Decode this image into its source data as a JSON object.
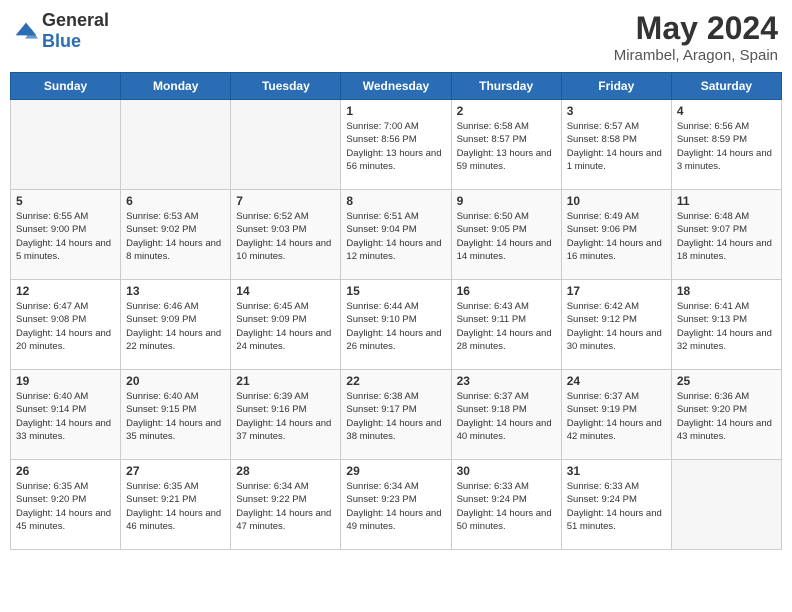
{
  "header": {
    "logo_general": "General",
    "logo_blue": "Blue",
    "month_year": "May 2024",
    "location": "Mirambel, Aragon, Spain"
  },
  "weekdays": [
    "Sunday",
    "Monday",
    "Tuesday",
    "Wednesday",
    "Thursday",
    "Friday",
    "Saturday"
  ],
  "weeks": [
    [
      {
        "day": "",
        "empty": true
      },
      {
        "day": "",
        "empty": true
      },
      {
        "day": "",
        "empty": true
      },
      {
        "day": "1",
        "sunrise": "7:00 AM",
        "sunset": "8:56 PM",
        "daylight": "13 hours and 56 minutes."
      },
      {
        "day": "2",
        "sunrise": "6:58 AM",
        "sunset": "8:57 PM",
        "daylight": "13 hours and 59 minutes."
      },
      {
        "day": "3",
        "sunrise": "6:57 AM",
        "sunset": "8:58 PM",
        "daylight": "14 hours and 1 minute."
      },
      {
        "day": "4",
        "sunrise": "6:56 AM",
        "sunset": "8:59 PM",
        "daylight": "14 hours and 3 minutes."
      }
    ],
    [
      {
        "day": "5",
        "sunrise": "6:55 AM",
        "sunset": "9:00 PM",
        "daylight": "14 hours and 5 minutes."
      },
      {
        "day": "6",
        "sunrise": "6:53 AM",
        "sunset": "9:02 PM",
        "daylight": "14 hours and 8 minutes."
      },
      {
        "day": "7",
        "sunrise": "6:52 AM",
        "sunset": "9:03 PM",
        "daylight": "14 hours and 10 minutes."
      },
      {
        "day": "8",
        "sunrise": "6:51 AM",
        "sunset": "9:04 PM",
        "daylight": "14 hours and 12 minutes."
      },
      {
        "day": "9",
        "sunrise": "6:50 AM",
        "sunset": "9:05 PM",
        "daylight": "14 hours and 14 minutes."
      },
      {
        "day": "10",
        "sunrise": "6:49 AM",
        "sunset": "9:06 PM",
        "daylight": "14 hours and 16 minutes."
      },
      {
        "day": "11",
        "sunrise": "6:48 AM",
        "sunset": "9:07 PM",
        "daylight": "14 hours and 18 minutes."
      }
    ],
    [
      {
        "day": "12",
        "sunrise": "6:47 AM",
        "sunset": "9:08 PM",
        "daylight": "14 hours and 20 minutes."
      },
      {
        "day": "13",
        "sunrise": "6:46 AM",
        "sunset": "9:09 PM",
        "daylight": "14 hours and 22 minutes."
      },
      {
        "day": "14",
        "sunrise": "6:45 AM",
        "sunset": "9:09 PM",
        "daylight": "14 hours and 24 minutes."
      },
      {
        "day": "15",
        "sunrise": "6:44 AM",
        "sunset": "9:10 PM",
        "daylight": "14 hours and 26 minutes."
      },
      {
        "day": "16",
        "sunrise": "6:43 AM",
        "sunset": "9:11 PM",
        "daylight": "14 hours and 28 minutes."
      },
      {
        "day": "17",
        "sunrise": "6:42 AM",
        "sunset": "9:12 PM",
        "daylight": "14 hours and 30 minutes."
      },
      {
        "day": "18",
        "sunrise": "6:41 AM",
        "sunset": "9:13 PM",
        "daylight": "14 hours and 32 minutes."
      }
    ],
    [
      {
        "day": "19",
        "sunrise": "6:40 AM",
        "sunset": "9:14 PM",
        "daylight": "14 hours and 33 minutes."
      },
      {
        "day": "20",
        "sunrise": "6:40 AM",
        "sunset": "9:15 PM",
        "daylight": "14 hours and 35 minutes."
      },
      {
        "day": "21",
        "sunrise": "6:39 AM",
        "sunset": "9:16 PM",
        "daylight": "14 hours and 37 minutes."
      },
      {
        "day": "22",
        "sunrise": "6:38 AM",
        "sunset": "9:17 PM",
        "daylight": "14 hours and 38 minutes."
      },
      {
        "day": "23",
        "sunrise": "6:37 AM",
        "sunset": "9:18 PM",
        "daylight": "14 hours and 40 minutes."
      },
      {
        "day": "24",
        "sunrise": "6:37 AM",
        "sunset": "9:19 PM",
        "daylight": "14 hours and 42 minutes."
      },
      {
        "day": "25",
        "sunrise": "6:36 AM",
        "sunset": "9:20 PM",
        "daylight": "14 hours and 43 minutes."
      }
    ],
    [
      {
        "day": "26",
        "sunrise": "6:35 AM",
        "sunset": "9:20 PM",
        "daylight": "14 hours and 45 minutes."
      },
      {
        "day": "27",
        "sunrise": "6:35 AM",
        "sunset": "9:21 PM",
        "daylight": "14 hours and 46 minutes."
      },
      {
        "day": "28",
        "sunrise": "6:34 AM",
        "sunset": "9:22 PM",
        "daylight": "14 hours and 47 minutes."
      },
      {
        "day": "29",
        "sunrise": "6:34 AM",
        "sunset": "9:23 PM",
        "daylight": "14 hours and 49 minutes."
      },
      {
        "day": "30",
        "sunrise": "6:33 AM",
        "sunset": "9:24 PM",
        "daylight": "14 hours and 50 minutes."
      },
      {
        "day": "31",
        "sunrise": "6:33 AM",
        "sunset": "9:24 PM",
        "daylight": "14 hours and 51 minutes."
      },
      {
        "day": "",
        "empty": true
      }
    ]
  ],
  "labels": {
    "sunrise_prefix": "Sunrise: ",
    "sunset_prefix": "Sunset: ",
    "daylight_prefix": "Daylight: "
  },
  "colors": {
    "header_bg": "#2a6db5",
    "alt_row": "#f9f9f9",
    "empty_bg": "#f5f5f5"
  }
}
